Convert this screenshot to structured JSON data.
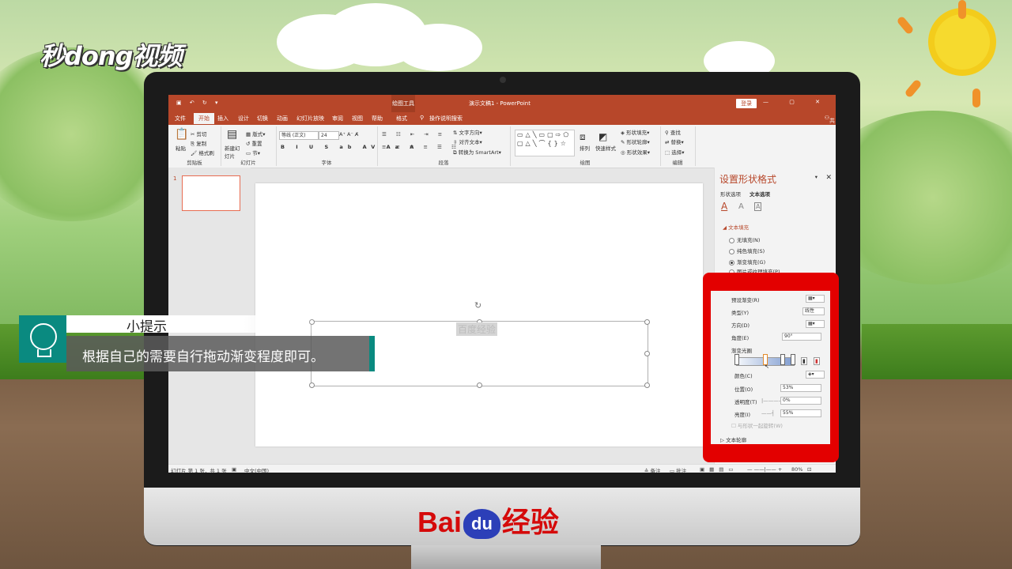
{
  "brand": {
    "logo_text": "秒dong视频",
    "footer_brand_left": "Bai",
    "footer_brand_du": "du",
    "footer_brand_right": "经验"
  },
  "window": {
    "title": "演示文稿1 - PowerPoint",
    "context_tab": "绘图工具",
    "login_button": "登录",
    "share": "共享",
    "accent": "#b7472a"
  },
  "tabs": [
    "文件",
    "开始",
    "插入",
    "设计",
    "切换",
    "动画",
    "幻灯片放映",
    "审阅",
    "视图",
    "帮助",
    "格式",
    "操作说明搜索"
  ],
  "ribbon": {
    "clipboard": {
      "paste": "粘贴",
      "cut": "剪切",
      "copy": "复制",
      "format_painter": "格式刷",
      "label": "剪贴板"
    },
    "slides": {
      "new_slide": "新建幻灯片",
      "layout": "版式",
      "reset": "重置",
      "section": "节",
      "label": "幻灯片"
    },
    "font": {
      "font_name": "等线 (正文)",
      "font_size": "24",
      "label": "字体"
    },
    "paragraph": {
      "text_direction": "文字方向",
      "align_text": "对齐文本",
      "smartart": "转换为 SmartArt",
      "label": "段落"
    },
    "drawing": {
      "arrange": "排列",
      "quick_styles": "快速样式",
      "shape_fill": "形状填充",
      "shape_outline": "形状轮廓",
      "shape_effects": "形状效果",
      "label": "绘图"
    },
    "editing": {
      "find": "查找",
      "replace": "替换",
      "select": "选择",
      "label": "编辑"
    }
  },
  "slides_panel": {
    "number": "1"
  },
  "slide": {
    "textbox_text": "百度经验"
  },
  "format_pane": {
    "title": "设置形状格式",
    "tab_shape": "形状选项",
    "tab_text": "文本选项",
    "section_fill": "文本填充",
    "options": [
      "无填充(N)",
      "纯色填充(S)",
      "渐变填充(G)",
      "图片或纹理填充(P)"
    ],
    "selected_option": 2,
    "section_outline": "文本轮廓"
  },
  "gradient": {
    "preset_label": "预设渐变(R)",
    "type_label": "类型(Y)",
    "type_value": "线性",
    "direction_label": "方向(D)",
    "angle_label": "角度(E)",
    "angle_value": "90°",
    "stops_label": "渐变光圈",
    "color_label": "颜色(C)",
    "position_label": "位置(O)",
    "position_value": "53%",
    "transparency_label": "透明度(T)",
    "transparency_value": "0%",
    "brightness_label": "亮度(I)",
    "brightness_value": "55%",
    "rotate_label": "与形状一起旋转(W)"
  },
  "status_bar": {
    "slide_info": "幻灯片 第 1 张，共 1 张",
    "language": "中文(中国)",
    "notes": "备注",
    "comments": "批注",
    "zoom": "80%"
  },
  "tip": {
    "title": "小提示",
    "text": "根据自己的需要自行拖动渐变程度即可。"
  }
}
